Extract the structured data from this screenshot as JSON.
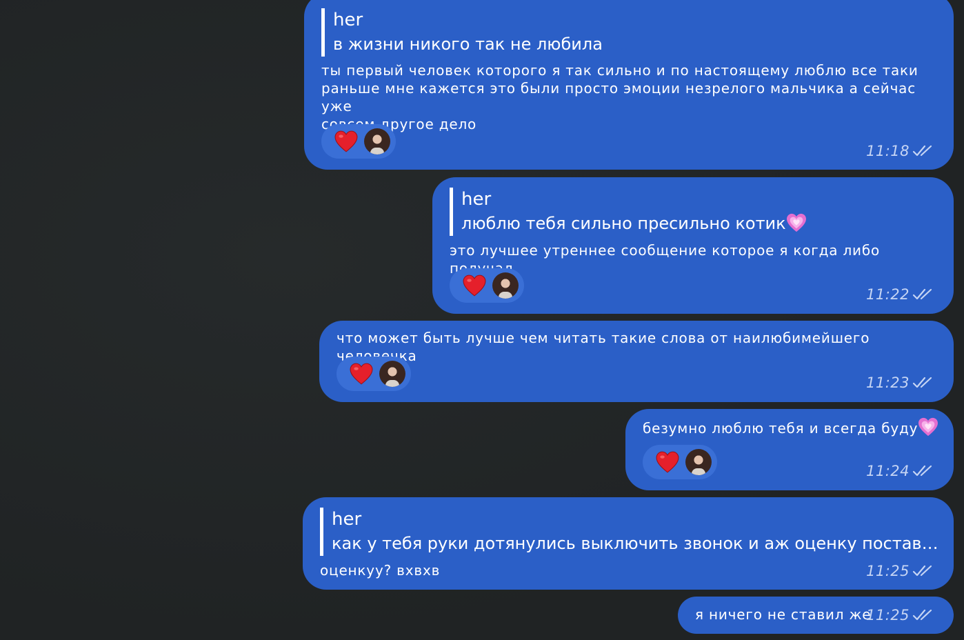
{
  "messages": [
    {
      "reply_author": "her",
      "reply_text": "в жизни никого так не любила",
      "text": "ты первый человек которого я так сильно и по настоящему люблю все таки\nраньше мне кажется это были просто эмоции незрелого мальчика а сейчас уже\nсовсем другое дело",
      "time": "11:18",
      "reaction": "red-heart"
    },
    {
      "reply_author": "her",
      "reply_text": "люблю тебя сильно пресильно котик",
      "reply_emoji": "sparkling-heart",
      "text": "это лучшее утреннее сообщение которое я когда либо получал",
      "time": "11:22",
      "reaction": "red-heart"
    },
    {
      "text": "что может быть лучше чем читать такие слова от наилюбимейшего человечка",
      "time": "11:23",
      "reaction": "red-heart"
    },
    {
      "text": "безумно люблю тебя и всегда буду",
      "text_emoji": "sparkling-heart",
      "time": "11:24",
      "reaction": "red-heart"
    },
    {
      "reply_author": "her",
      "reply_text": "как у тебя руки дотянулись выключить звонок и аж оценку постави...",
      "text": "оценкуу? вхвхв",
      "time": "11:25"
    },
    {
      "text": "я ничего не ставил же",
      "time": "11:25"
    }
  ],
  "colors": {
    "background": "#222526",
    "bubble": "#2b5fc7",
    "reaction_pill": "#3a6fd6",
    "meta": "#c6d5f4",
    "heart_red": "#e5202b",
    "heart_pink": "#e46fd0"
  },
  "icons": {
    "read_status": "double-check-icon",
    "reaction_heart": "red-heart-icon",
    "text_emoji": "sparkling-heart-icon"
  }
}
